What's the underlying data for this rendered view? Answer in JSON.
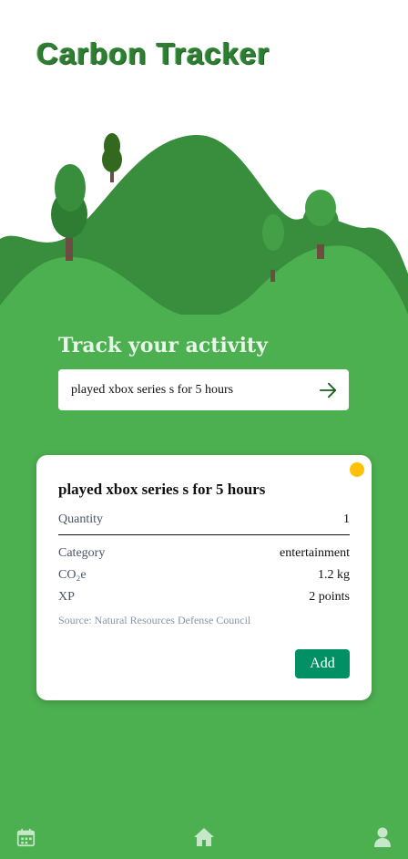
{
  "app": {
    "title": "Carbon Tracker"
  },
  "search": {
    "heading": "Track your activity",
    "value": "played xbox series s for 5 hours"
  },
  "result": {
    "title": "played xbox series s for 5 hours",
    "quantity_label": "Quantity",
    "quantity_value": "1",
    "category_label": "Category",
    "category_value": "entertainment",
    "co2_label": "CO₂e",
    "co2_value": "1.2 kg",
    "xp_label": "XP",
    "xp_value": "2 points",
    "source": "Source: Natural Resources Defense Council",
    "add_label": "Add"
  },
  "nav": {
    "items": [
      "calendar-icon",
      "home-icon",
      "profile-icon"
    ]
  },
  "colors": {
    "background": "#4caf50",
    "accent": "#009063",
    "status_dot": "#ffc107",
    "title": "#2e7d32"
  }
}
